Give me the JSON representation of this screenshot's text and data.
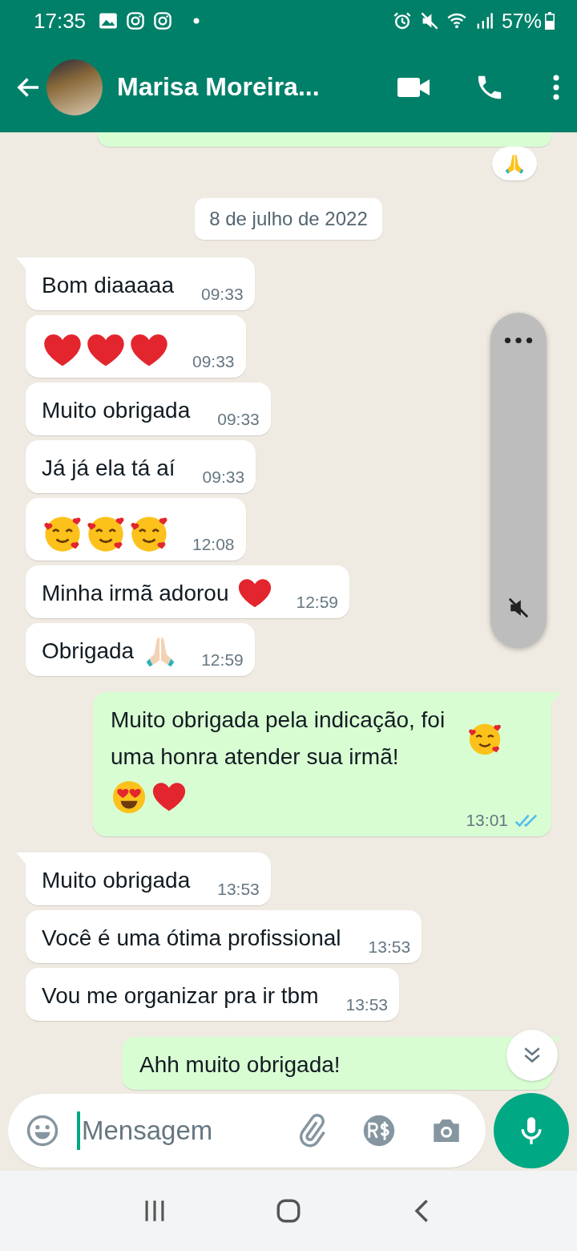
{
  "status_bar": {
    "time": "17:35",
    "battery": "57%"
  },
  "header": {
    "contact_name": "Marisa Moreira..."
  },
  "reaction": {
    "kind": "praying-hands"
  },
  "date_chip": "8 de julho de 2022",
  "messages": [
    {
      "outgoing": false,
      "tail": true,
      "text": "Bom diaaaaa",
      "time": "09:33"
    },
    {
      "outgoing": false,
      "tail": false,
      "emojis": [
        {
          "kind": "heart"
        },
        {
          "kind": "heart"
        },
        {
          "kind": "heart"
        }
      ],
      "time": "09:33"
    },
    {
      "outgoing": false,
      "tail": false,
      "text": "Muito obrigada",
      "time": "09:33"
    },
    {
      "outgoing": false,
      "tail": false,
      "text": "Já já ela tá aí",
      "time": "09:33"
    },
    {
      "outgoing": false,
      "tail": false,
      "emojis": [
        {
          "kind": "hearts-face"
        },
        {
          "kind": "hearts-face"
        },
        {
          "kind": "hearts-face"
        }
      ],
      "time": "12:08"
    },
    {
      "outgoing": false,
      "tail": false,
      "text": "Minha irmã adorou",
      "inline_emojis": [
        {
          "kind": "heart"
        }
      ],
      "time": "12:59"
    },
    {
      "outgoing": false,
      "tail": false,
      "text": "Obrigada",
      "inline_emojis": [
        {
          "kind": "praying-hands-light"
        }
      ],
      "time": "12:59"
    },
    {
      "outgoing": true,
      "tail": true,
      "text": "Muito obrigada pela indicação, foi uma honra atender sua irmã!",
      "inline_emojis": [
        {
          "kind": "hearts-face"
        },
        {
          "kind": "heart-eyes"
        },
        {
          "kind": "heart"
        }
      ],
      "time": "13:01",
      "read": true
    },
    {
      "outgoing": false,
      "tail": true,
      "text": "Muito obrigada",
      "time": "13:53"
    },
    {
      "outgoing": false,
      "tail": false,
      "text": "Você é uma ótima profissional",
      "time": "13:53"
    },
    {
      "outgoing": false,
      "tail": false,
      "text": "Vou me organizar pra ir tbm",
      "time": "13:53"
    },
    {
      "outgoing": true,
      "tail": true,
      "text": "Ahh muito obrigada!",
      "partial": true
    }
  ],
  "composer": {
    "placeholder": "Mensagem"
  }
}
